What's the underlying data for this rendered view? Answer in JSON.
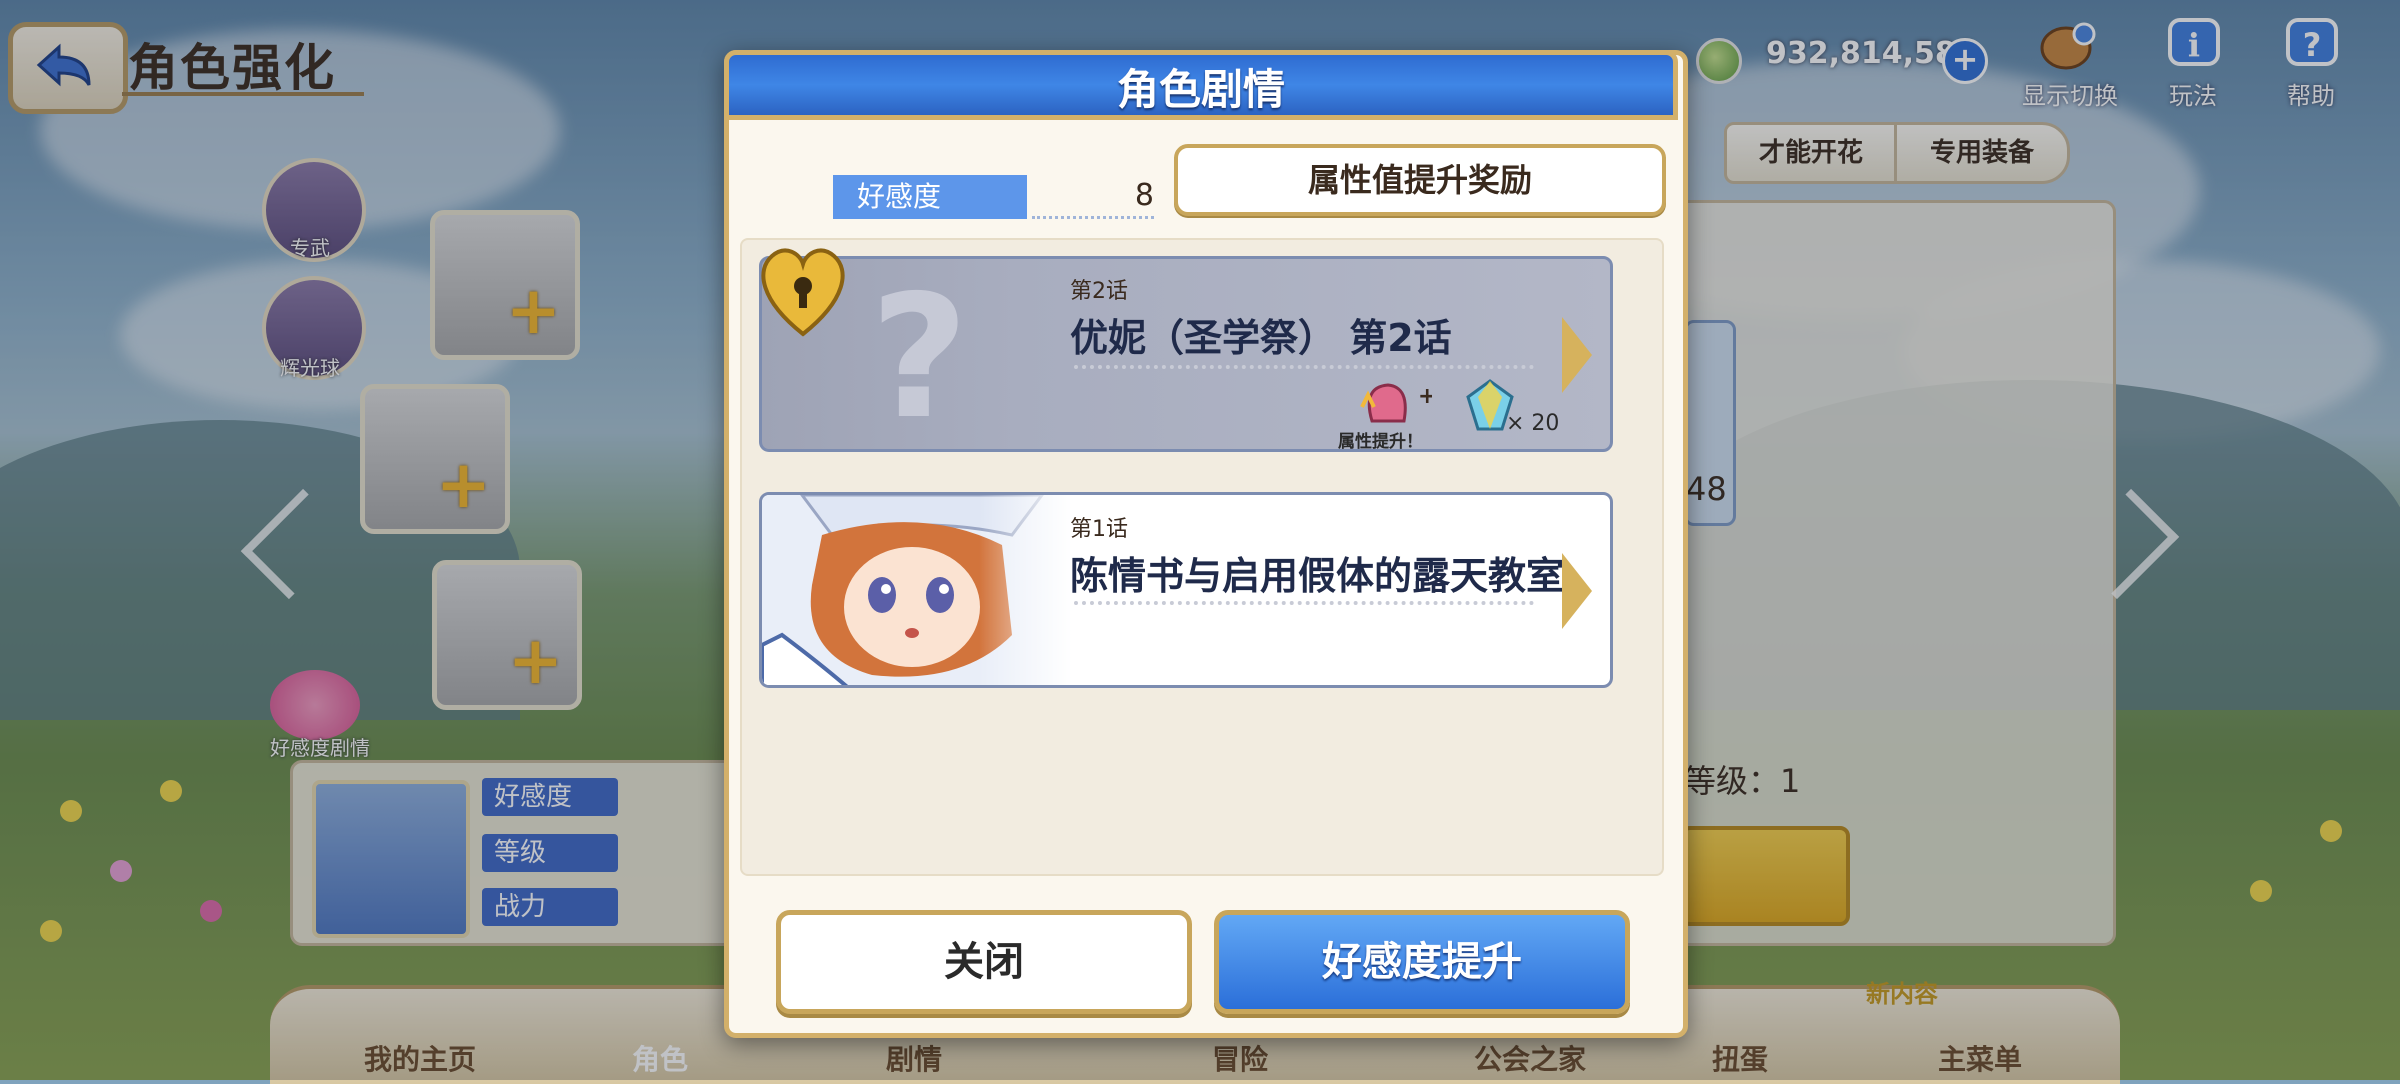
{
  "topbar": {
    "back_icon": "back-arrow-icon",
    "page_title": "角色强化",
    "currency_value": "932,814,588",
    "plus_symbol": "+",
    "buttons": [
      {
        "label": "显示切换",
        "icon": "character-toggle-icon"
      },
      {
        "label": "玩法",
        "icon": "info-icon"
      },
      {
        "label": "帮助",
        "icon": "help-icon"
      }
    ]
  },
  "sidebar": {
    "round_buttons": [
      "专武",
      "辉光球"
    ],
    "favorite_label": "好感度剧情",
    "stat_labels": [
      "好感度",
      "等级",
      "战力"
    ]
  },
  "right_panel": {
    "tabs": [
      "才能开花",
      "专用装备"
    ],
    "level_text": "等级：1",
    "partial_number": "48"
  },
  "bottom_nav": {
    "items": [
      "我的主页",
      "角色",
      "剧情",
      "冒险",
      "公会之家",
      "扭蛋",
      "主菜单"
    ],
    "badge": "新内容"
  },
  "modal": {
    "title": "角色剧情",
    "affinity_label": "好感度",
    "affinity_value": "8",
    "reward_button": "属性值提升奖励",
    "episodes": [
      {
        "number": "第2话",
        "title": "优妮（圣学祭） 第2话",
        "locked": true,
        "bonus_label": "属性提升！",
        "gem_count": "× 20"
      },
      {
        "number": "第1话",
        "title": "陈情书与启用假体的露天教室",
        "locked": false
      }
    ],
    "close_button": "关闭",
    "raise_button": "好感度提升"
  },
  "colors": {
    "header_blue": "#3f86e6",
    "gold_border": "#d3b06a",
    "primary_button": "#2b6fd9"
  }
}
